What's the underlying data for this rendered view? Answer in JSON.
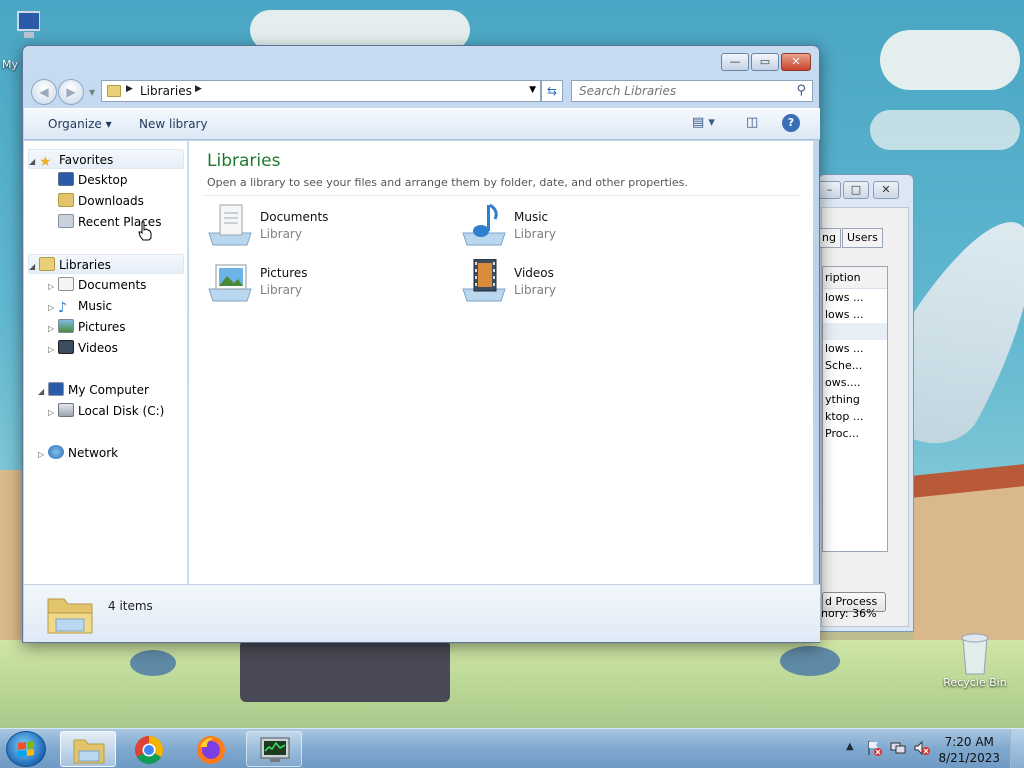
{
  "desktop": {
    "icons": [
      {
        "label": "My"
      },
      {
        "label": "Recycle Bin"
      }
    ]
  },
  "task_manager": {
    "tabs": [
      "ng",
      "Users"
    ],
    "column": "ription",
    "rows": [
      "lows ...",
      "lows ...",
      "",
      "lows ...",
      "Sche...",
      "ows....",
      "ything",
      "ktop ...",
      "Proc..."
    ],
    "button": "d Process",
    "memory": "nory: 36%",
    "caption_min": "–",
    "caption_max": "□",
    "caption_close": "✕"
  },
  "explorer": {
    "caption": {
      "minimize": "—",
      "maximize": "▭",
      "close": "✕"
    },
    "address": {
      "crumb": "Libraries"
    },
    "search": {
      "placeholder": "Search Libraries"
    },
    "toolbar": {
      "organize": "Organize ▾",
      "new_library": "New library"
    },
    "nav": {
      "favorites": {
        "label": "Favorites",
        "items": [
          "Desktop",
          "Downloads",
          "Recent Places"
        ]
      },
      "libraries": {
        "label": "Libraries",
        "items": [
          "Documents",
          "Music",
          "Pictures",
          "Videos"
        ]
      },
      "computer": {
        "label": "My Computer",
        "items": [
          "Local Disk (C:)"
        ]
      },
      "network": {
        "label": "Network"
      }
    },
    "content": {
      "title": "Libraries",
      "subtitle": "Open a library to see your files and arrange them by folder, date, and other properties.",
      "libraries": [
        {
          "name": "Documents",
          "type": "Library",
          "icon": "documents-library-icon"
        },
        {
          "name": "Music",
          "type": "Library",
          "icon": "music-library-icon"
        },
        {
          "name": "Pictures",
          "type": "Library",
          "icon": "pictures-library-icon"
        },
        {
          "name": "Videos",
          "type": "Library",
          "icon": "videos-library-icon"
        }
      ]
    },
    "status": {
      "count": "4 items"
    }
  },
  "taskbar": {
    "clock": {
      "time": "7:20 AM",
      "date": "8/21/2023"
    }
  },
  "colors": {
    "title_green": "#1e7a2e",
    "window_frame": "#b9d1ec",
    "taskbar": "#7fa9cf"
  }
}
